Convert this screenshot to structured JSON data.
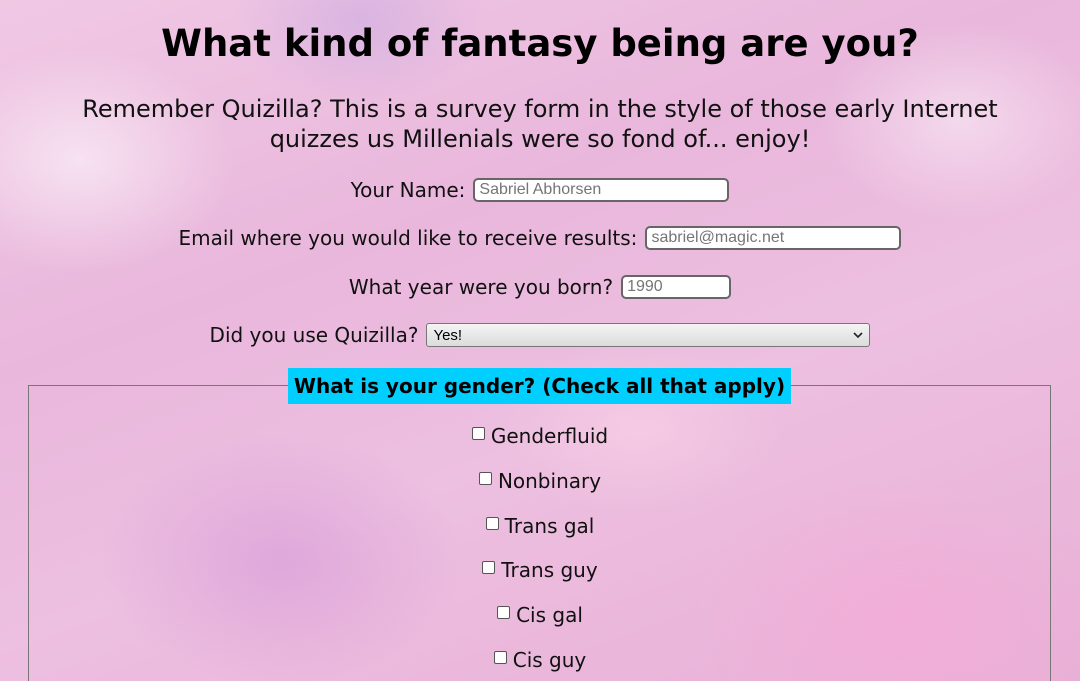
{
  "header": {
    "title": "What kind of fantasy being are you?",
    "subtitle": "Remember Quizilla? This is a survey form in the style of those early Internet quizzes us Millenials were so fond of... enjoy!"
  },
  "form": {
    "name": {
      "label": "Your Name:",
      "placeholder": "Sabriel Abhorsen"
    },
    "email": {
      "label": "Email where you would like to receive results:",
      "placeholder": "sabriel@magic.net"
    },
    "year": {
      "label": "What year were you born?",
      "placeholder": "1990"
    },
    "quizilla": {
      "label": "Did you use Quizilla?",
      "selected": "Yes!"
    }
  },
  "gender": {
    "legend": "What is your gender? (Check all that apply)",
    "options": [
      "Genderfluid",
      "Nonbinary",
      "Trans gal",
      "Trans guy",
      "Cis gal",
      "Cis guy"
    ]
  },
  "colors": {
    "legend_bg": "#00cfff",
    "background": "#edbfe0"
  },
  "icons": {
    "select_arrow": "chevron-down-icon"
  }
}
